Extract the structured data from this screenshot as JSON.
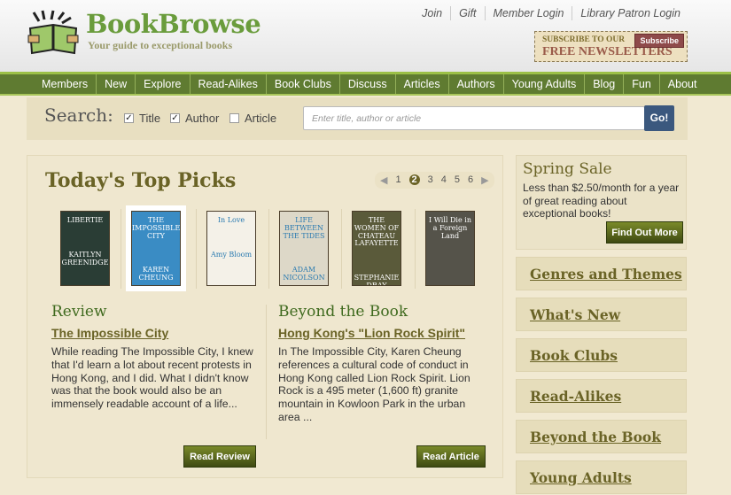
{
  "header": {
    "brand": "BookBrowse",
    "tagline": "Your guide to exceptional books",
    "top_links": [
      "Join",
      "Gift",
      "Member Login",
      "Library Patron Login"
    ],
    "newsletter": {
      "line1": "SUBSCRIBE TO OUR",
      "line2": "FREE NEWSLETTERS",
      "button": "Subscribe"
    }
  },
  "nav": [
    "Members",
    "New",
    "Explore",
    "Read-Alikes",
    "Book Clubs",
    "Discuss",
    "Articles",
    "Authors",
    "Young Adults",
    "Blog",
    "Fun",
    "About"
  ],
  "search": {
    "label": "Search:",
    "options": [
      {
        "label": "Title",
        "checked": true
      },
      {
        "label": "Author",
        "checked": true
      },
      {
        "label": "Article",
        "checked": false
      }
    ],
    "placeholder": "Enter title, author or article",
    "go": "Go!"
  },
  "picks": {
    "title": "Today's Top Picks",
    "pages": [
      "1",
      "2",
      "3",
      "4",
      "5",
      "6"
    ],
    "current_page": "2",
    "covers": [
      {
        "title": "LIBERTIE",
        "author": "KAITLYN GREENIDGE",
        "color": "#2a3d35"
      },
      {
        "title": "THE IMPOSSIBLE CITY",
        "author": "KAREN CHEUNG",
        "color": "#3a8cc4"
      },
      {
        "title": "In Love",
        "author": "Amy Bloom",
        "color": "#f4f1e8"
      },
      {
        "title": "LIFE BETWEEN THE TIDES",
        "author": "ADAM NICOLSON",
        "color": "#ddd8c8"
      },
      {
        "title": "THE WOMEN OF CHATEAU LAFAYETTE",
        "author": "STEPHANIE DRAY",
        "color": "#5a5a3a"
      },
      {
        "title": "I Will Die in a Foreign Land",
        "author": "",
        "color": "#55534a"
      }
    ],
    "review": {
      "heading": "Review",
      "link": "The Impossible City",
      "text": "While reading The Impossible City, I knew that I'd learn a lot about recent protests in Hong Kong, and I did. What I didn't know was that the book would also be an immensely readable account of a life...",
      "button": "Read Review"
    },
    "beyond": {
      "heading": "Beyond the Book",
      "link": "Hong Kong's \"Lion Rock Spirit\"",
      "text": "In The Impossible City, Karen Cheung references a cultural code of conduct in Hong Kong called Lion Rock Spirit. Lion Rock is a 495 meter (1,600 ft) granite mountain in Kowloon Park in the urban area ...",
      "button": "Read Article"
    }
  },
  "sale": {
    "title": "Spring Sale",
    "text": "Less than $2.50/month for a year of great reading about exceptional books!",
    "button": "Find Out More"
  },
  "sidebar": [
    "Genres and Themes",
    "What's New",
    "Book Clubs",
    "Read-Alikes",
    "Beyond the Book",
    "Young Adults"
  ]
}
